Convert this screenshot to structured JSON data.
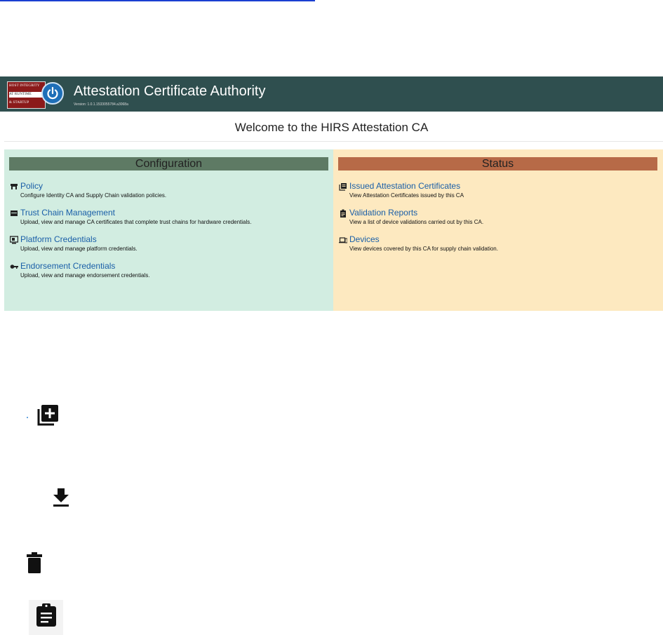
{
  "banner": {
    "logo_line1": "HOST INTEGRITY",
    "logo_line2": "AT RUNTIME",
    "logo_line3": "& STARTUP",
    "title": "Attestation Certificate Authority",
    "version": "Version: 1.0.1.1533055784.a3068a"
  },
  "welcome": "Welcome to the HIRS Attestation CA",
  "configuration": {
    "heading": "Configuration",
    "items": [
      {
        "label": "Policy",
        "desc": "Configure Identity CA and Supply Chain validation policies.",
        "icon": "policy-icon"
      },
      {
        "label": "Trust Chain Management",
        "desc": "Upload, view and manage CA certificates that complete trust chains for hardware credentials.",
        "icon": "trust-chain-icon"
      },
      {
        "label": "Platform Credentials",
        "desc": "Upload, view and manage platform credentials.",
        "icon": "platform-icon"
      },
      {
        "label": "Endorsement Credentials",
        "desc": "Upload, view and manage endorsement credentials.",
        "icon": "key-icon"
      }
    ]
  },
  "status": {
    "heading": "Status",
    "items": [
      {
        "label": "Issued Attestation Certificates",
        "desc": "View Attestation Certificates issued by this CA",
        "icon": "library-books-icon"
      },
      {
        "label": "Validation Reports",
        "desc": "View a list of device validations carried out by this CA.",
        "icon": "assignment-icon"
      },
      {
        "label": "Devices",
        "desc": "View devices covered by this CA for supply chain validation.",
        "icon": "devices-icon"
      }
    ]
  },
  "colors": {
    "banner": "#2f4f4f",
    "config_bg": "#d2ede1",
    "config_head": "#5e7a64",
    "status_bg": "#fde9c0",
    "status_head": "#b76a47",
    "link": "#1a5fa8"
  }
}
